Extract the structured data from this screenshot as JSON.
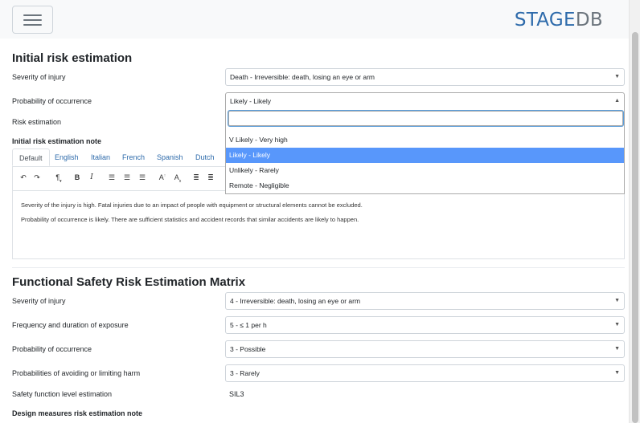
{
  "app": {
    "logo_part1": "STAGE",
    "logo_part2": "DB"
  },
  "section1": {
    "title": "Initial risk estimation",
    "severity": {
      "label": "Severity of injury",
      "value": "Death - Irreversible: death, losing an eye or arm"
    },
    "probability": {
      "label": "Probability of occurrence",
      "value": "Likely - Likely",
      "search_value": ""
    },
    "risk_estimation": {
      "label": "Risk estimation"
    },
    "note_label": "Initial risk estimation note",
    "options": [
      "V Likely - Very high",
      "Likely - Likely",
      "Unlikely - Rarely",
      "Remote - Negligible"
    ],
    "tabs": [
      "Default",
      "English",
      "Italian",
      "French",
      "Spanish",
      "Dutch"
    ],
    "toolbar_icons": [
      "undo-icon",
      "redo-icon",
      "paragraph-icon",
      "bold-icon",
      "italic-icon",
      "align-left-icon",
      "align-center-icon",
      "align-right-icon",
      "font-size-icon",
      "subscript-icon",
      "bullet-list-icon",
      "numbered-list-icon"
    ],
    "note_text": [
      "Severity of the injury is high. Fatal injuries due to an impact of people with equipment or structural elements cannot be excluded.",
      "Probability of occurrence is likely. There are sufficient statistics and accident records that similar accidents are likely to happen."
    ]
  },
  "section2": {
    "title": "Functional Safety Risk Estimation Matrix",
    "severity": {
      "label": "Severity of injury",
      "value": "4 - Irreversible: death, losing an eye or arm"
    },
    "frequency": {
      "label": "Frequency and duration of exposure",
      "value": "5 - ≤ 1 per h"
    },
    "probability": {
      "label": "Probability of occurrence",
      "value": "3 - Possible"
    },
    "avoiding": {
      "label": "Probabilities of avoiding or limiting harm",
      "value": "3 - Rarely"
    },
    "sil": {
      "label": "Safety function level estimation",
      "value": "SIL3"
    },
    "design_note_label": "Design measures risk estimation note"
  },
  "colors": {
    "accent": "#2e6bab",
    "selected_option": "#5897fb"
  }
}
